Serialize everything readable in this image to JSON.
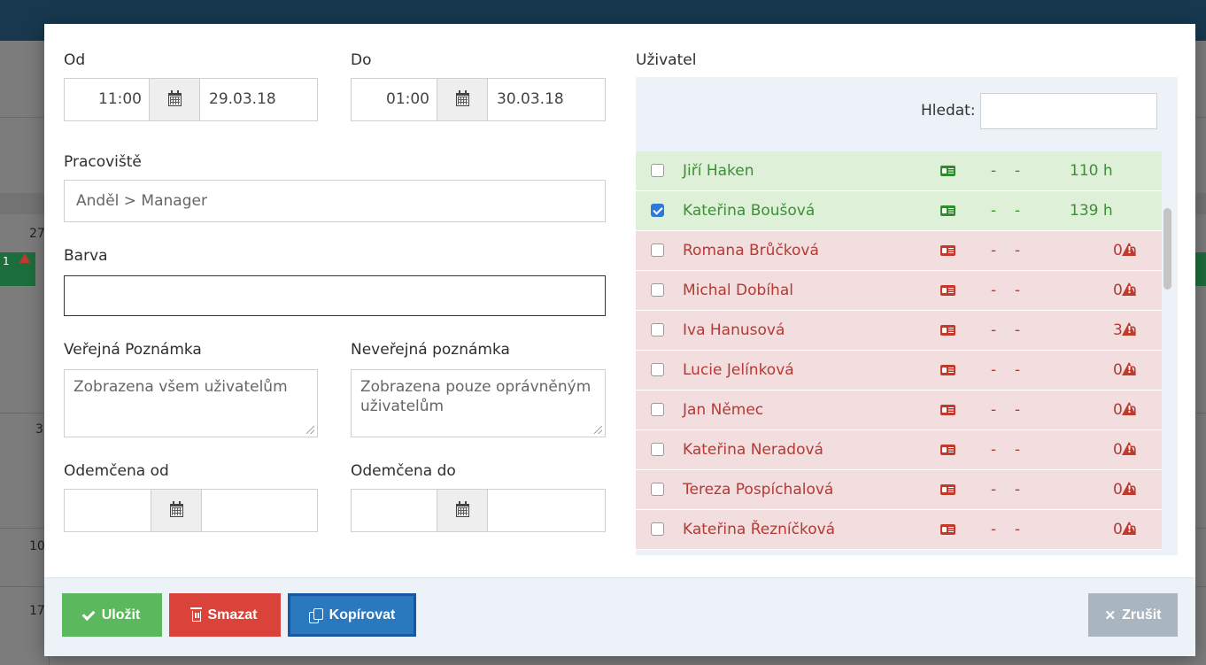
{
  "background": {
    "numbers": [
      "27",
      "1",
      "3",
      "10",
      "17"
    ]
  },
  "form": {
    "od_label": "Od",
    "od_time": "11:00",
    "od_date": "29.03.18",
    "do_label": "Do",
    "do_time": "01:00",
    "do_date": "30.03.18",
    "pracoviste_label": "Pracoviště",
    "pracoviste_placeholder": "Anděl > Manager",
    "barva_label": "Barva",
    "verejna_label": "Veřejná Poznámka",
    "verejna_placeholder": "Zobrazena všem uživatelům",
    "neverejna_label": "Neveřejná poznámka",
    "neverejna_placeholder": "Zobrazena pouze oprávněným uživatelům",
    "odemcena_od_label": "Odemčena od",
    "odemcena_do_label": "Odemčena do"
  },
  "users": {
    "label": "Uživatel",
    "search_label": "Hledat:",
    "rows": [
      {
        "name": "Jiří Haken",
        "d1": "-",
        "d2": "-",
        "hours": "110 h",
        "status": "ok",
        "checked": false
      },
      {
        "name": "Kateřina Boušová",
        "d1": "-",
        "d2": "-",
        "hours": "139 h",
        "status": "ok",
        "checked": true
      },
      {
        "name": "Romana Brůčková",
        "d1": "-",
        "d2": "-",
        "hours": "0 h",
        "status": "bad",
        "checked": false
      },
      {
        "name": "Michal Dobíhal",
        "d1": "-",
        "d2": "-",
        "hours": "0 h",
        "status": "bad",
        "checked": false
      },
      {
        "name": "Iva Hanusová",
        "d1": "-",
        "d2": "-",
        "hours": "3 h",
        "status": "bad",
        "checked": false
      },
      {
        "name": "Lucie Jelínková",
        "d1": "-",
        "d2": "-",
        "hours": "0 h",
        "status": "bad",
        "checked": false
      },
      {
        "name": "Jan Němec",
        "d1": "-",
        "d2": "-",
        "hours": "0 h",
        "status": "bad",
        "checked": false
      },
      {
        "name": "Kateřina Neradová",
        "d1": "-",
        "d2": "-",
        "hours": "0 h",
        "status": "bad",
        "checked": false
      },
      {
        "name": "Tereza Pospíchalová",
        "d1": "-",
        "d2": "-",
        "hours": "0 h",
        "status": "bad",
        "checked": false
      },
      {
        "name": "Kateřina Řezníčková",
        "d1": "-",
        "d2": "-",
        "hours": "0 h",
        "status": "bad",
        "checked": false
      }
    ]
  },
  "footer": {
    "save_label": "Uložit",
    "delete_label": "Smazat",
    "copy_label": "Kopírovat",
    "cancel_label": "Zrušit"
  },
  "colors": {
    "save": "#5cb85c",
    "delete": "#d9433a",
    "copy": "#2a78be",
    "cancel": "#a9b5bf",
    "row_ok": "#dff0d8",
    "row_bad": "#f2dede"
  }
}
